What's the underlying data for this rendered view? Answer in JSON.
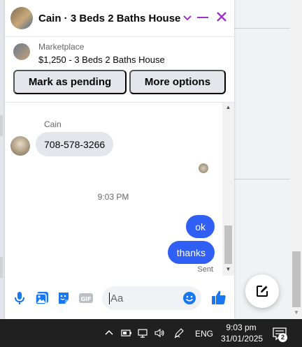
{
  "chat": {
    "title": "Cain · 3 Beds 2 Baths House",
    "marketplace_label": "Marketplace",
    "listing": "$1,250 - 3 Beds 2 Baths House",
    "mark_pending_label": "Mark as pending",
    "more_options_label": "More options",
    "accent_color": "#a033c8",
    "header_icons": [
      "chevron-down-icon",
      "minimize-icon",
      "close-icon"
    ]
  },
  "messages": {
    "sender_name": "Cain",
    "incoming": "708-578-3266",
    "timestamp": "9:03 PM",
    "outgoing": [
      "ok",
      "thanks"
    ],
    "status": "Sent",
    "bubble_color": "#2f5ff5"
  },
  "composer": {
    "placeholder": "Aa",
    "icons": [
      "microphone-icon",
      "photo-icon",
      "sticker-icon",
      "gif-icon",
      "emoji-icon",
      "thumbs-up-icon"
    ],
    "accent_color": "#1877f2"
  },
  "taskbar": {
    "language": "ENG",
    "time": "9:03 pm",
    "date": "31/01/2025",
    "notification_count": "2",
    "icons": [
      "chevron-up-icon",
      "battery-icon",
      "network-icon",
      "volume-icon",
      "pen-icon",
      "notification-icon"
    ]
  }
}
